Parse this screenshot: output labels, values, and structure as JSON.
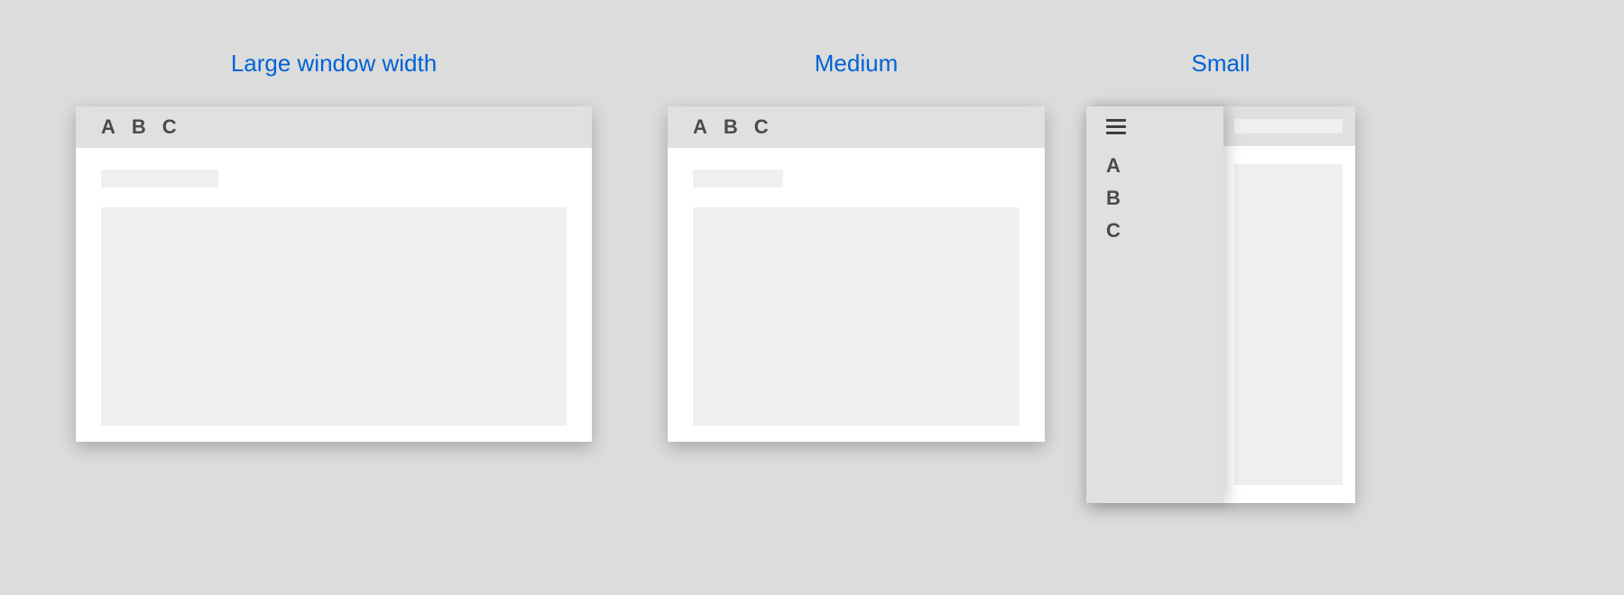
{
  "labels": {
    "large": "Large window width",
    "medium": "Medium",
    "small": "Small"
  },
  "tabs": {
    "a": "A",
    "b": "B",
    "c": "C"
  },
  "menu": {
    "a": "A",
    "b": "B",
    "c": "C"
  }
}
